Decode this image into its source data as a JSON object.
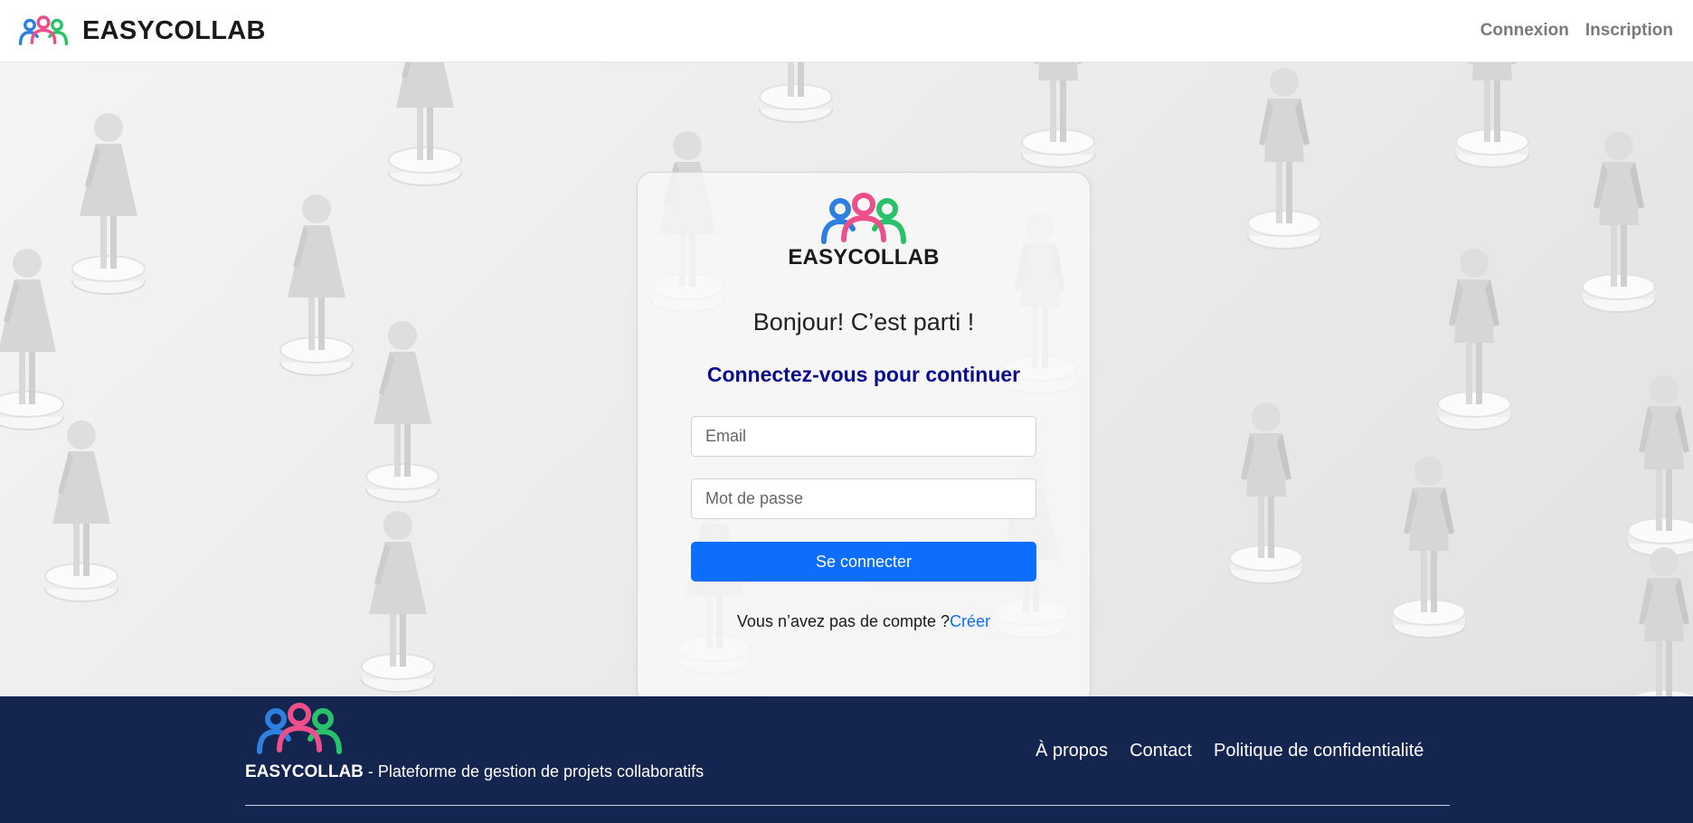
{
  "header": {
    "brand": "EASYCOLLAB",
    "nav": [
      {
        "label": "Connexion"
      },
      {
        "label": "Inscription"
      }
    ]
  },
  "card": {
    "brand": "EASYCOLLAB",
    "greeting": "Bonjour! C’est parti !",
    "subtitle": "Connectez-vous pour continuer",
    "email_placeholder": "Email",
    "password_placeholder": "Mot de passe",
    "submit_label": "Se connecter",
    "signup_prompt": "Vous n’avez pas de compte ?",
    "signup_link": "Créer"
  },
  "footer": {
    "brand": "EASYCOLLAB",
    "tagline": " - Plateforme de gestion de projets collaboratifs",
    "links": [
      {
        "label": "À propos"
      },
      {
        "label": "Contact"
      },
      {
        "label": "Politique de confidentialité"
      }
    ]
  },
  "colors": {
    "primary": "#0d6efd",
    "subtitle": "#0b0b8f",
    "footer_bg": "#14254f",
    "logo_blue": "#2d7fe0",
    "logo_pink": "#ec4f8a",
    "logo_green": "#29c26a"
  },
  "icons": {
    "logo": "three-people-logo-icon"
  }
}
